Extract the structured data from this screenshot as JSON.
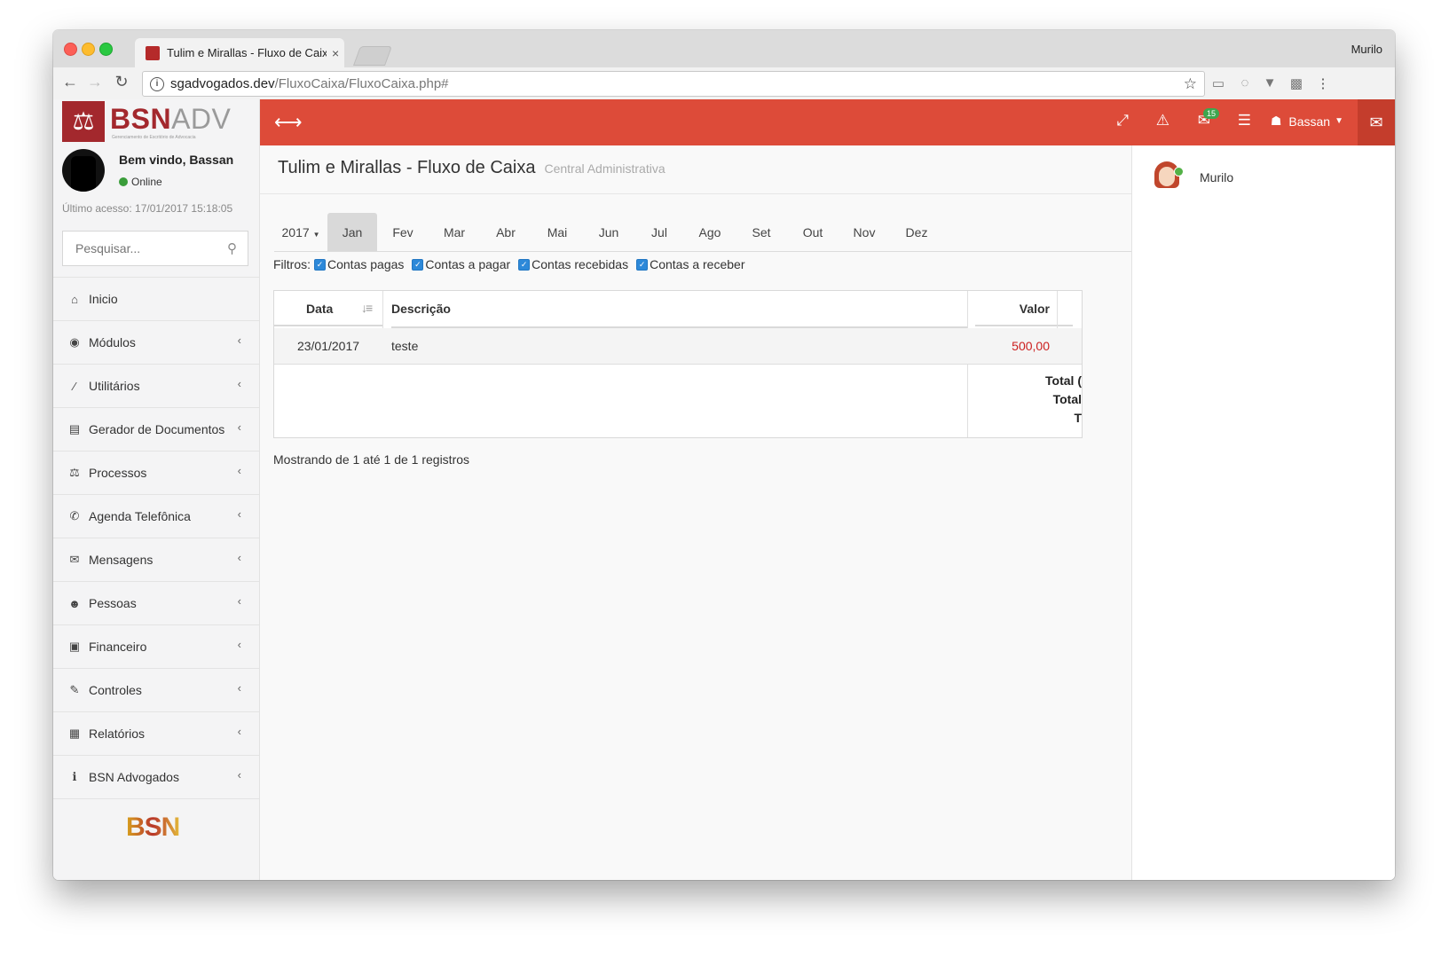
{
  "browser": {
    "tab_title": "Tulim e Mirallas - Fluxo de Caixa",
    "profile_name": "Murilo",
    "url_host": "sgadvogados.dev",
    "url_path": "/FluxoCaixa/FluxoCaixa.php#"
  },
  "sidebar": {
    "logo_bsn": "BSN",
    "logo_adv": "ADV",
    "logo_subtitle": "Gerenciamento de Escritório de Advocacia",
    "welcome": "Bem vindo, Bassan",
    "status": "Online",
    "last_access": "Último acesso: 17/01/2017 15:18:05",
    "search_placeholder": "Pesquisar...",
    "items": [
      {
        "label": "Inicio",
        "icon": "home-icon",
        "glyph": "⌂",
        "chevron": false
      },
      {
        "label": "Módulos",
        "icon": "user-circle-icon",
        "glyph": "◉",
        "chevron": true
      },
      {
        "label": "Utilitários",
        "icon": "magic-wand-icon",
        "glyph": "⁄",
        "chevron": true
      },
      {
        "label": "Gerador de Documentos",
        "icon": "document-icon",
        "glyph": "▤",
        "chevron": true
      },
      {
        "label": "Processos",
        "icon": "balance-scale-icon",
        "glyph": "⚖",
        "chevron": true
      },
      {
        "label": "Agenda Telefônica",
        "icon": "phone-icon",
        "glyph": "✆",
        "chevron": true
      },
      {
        "label": "Mensagens",
        "icon": "chat-bubbles-icon",
        "glyph": "✉",
        "chevron": true
      },
      {
        "label": "Pessoas",
        "icon": "users-icon",
        "glyph": "☻",
        "chevron": true
      },
      {
        "label": "Financeiro",
        "icon": "money-icon",
        "glyph": "▣",
        "chevron": true
      },
      {
        "label": "Controles",
        "icon": "wrench-icon",
        "glyph": "✎",
        "chevron": true
      },
      {
        "label": "Relatórios",
        "icon": "table-icon",
        "glyph": "▦",
        "chevron": true
      },
      {
        "label": "BSN Advogados",
        "icon": "info-icon",
        "glyph": "ℹ",
        "chevron": true
      }
    ],
    "footer_logo": "BSN"
  },
  "topbar": {
    "user_name": "Bassan",
    "messages_badge": "15"
  },
  "page": {
    "title": "Tulim e Mirallas - Fluxo de Caixa",
    "subtitle": "Central Administrativa"
  },
  "months": {
    "year": "2017",
    "list": [
      "Jan",
      "Fev",
      "Mar",
      "Abr",
      "Mai",
      "Jun",
      "Jul",
      "Ago",
      "Set",
      "Out",
      "Nov",
      "Dez"
    ],
    "active": "Jan"
  },
  "filters": {
    "label": "Filtros:",
    "options": [
      "Contas pagas",
      "Contas a pagar",
      "Contas recebidas",
      "Contas a receber"
    ]
  },
  "table": {
    "columns": [
      "Data",
      "Descrição",
      "Valor"
    ],
    "rows": [
      {
        "data": "23/01/2017",
        "descricao": "teste",
        "valor": "500,00"
      }
    ],
    "totals": [
      "Total (",
      "Total",
      "T"
    ],
    "value_color": "#cc2020"
  },
  "footer": {
    "showing": "Mostrando de 1 até 1 de 1 registros"
  },
  "chat": {
    "contacts": [
      {
        "name": "Murilo",
        "status": "online"
      }
    ]
  },
  "colors": {
    "topbar": "#dd4b39",
    "brand": "#a3282d",
    "online": "#3a9d3a"
  }
}
